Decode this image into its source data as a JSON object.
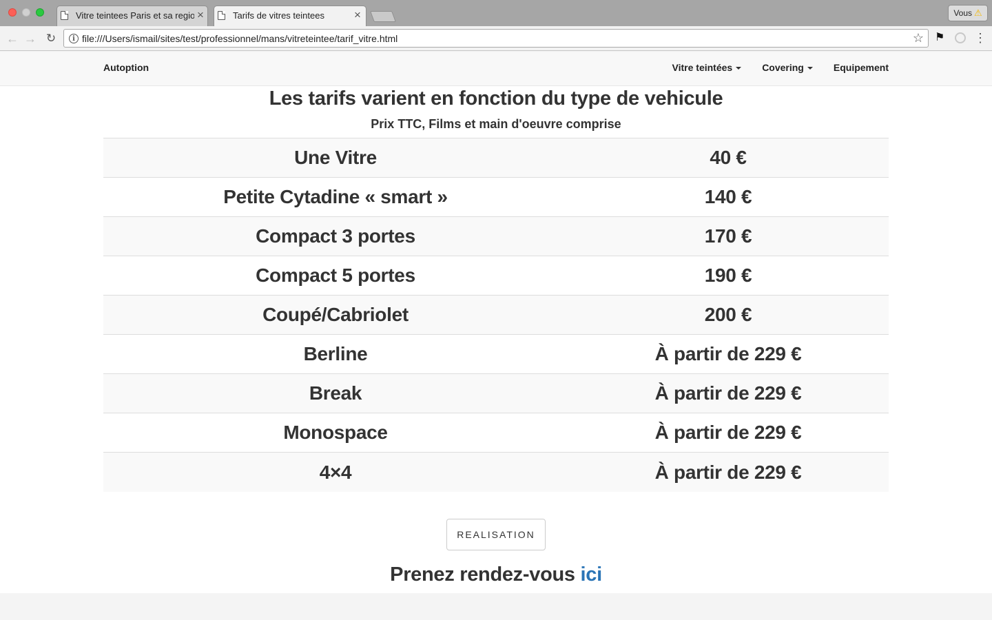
{
  "browser": {
    "tabs": [
      {
        "title": "Vitre teintees Paris et sa region"
      },
      {
        "title": "Tarifs de vitres teintees"
      }
    ],
    "url": "file:///Users/ismail/sites/test/professionnel/mans/vitreteintee/tarif_vitre.html",
    "profile_label": "Vous",
    "icons": {
      "back": "arrow-left-icon",
      "forward": "arrow-right-icon",
      "reload": "reload-icon",
      "info": "info-icon",
      "bookmark": "star-icon",
      "menu": "vertical-dots-icon"
    }
  },
  "navbar": {
    "brand": "Autoption",
    "links": [
      {
        "label": "Vitre teintées",
        "dropdown": true
      },
      {
        "label": "Covering",
        "dropdown": true
      },
      {
        "label": "Equipement",
        "dropdown": false
      }
    ]
  },
  "main": {
    "heading": "Les tarifs varient en fonction du type de vehicule",
    "subheading": "Prix TTC, Films et main d'oeuvre comprise",
    "pricing": [
      {
        "type": "Une Vitre",
        "price": "40 €"
      },
      {
        "type": "Petite Cytadine « smart »",
        "price": "140 €"
      },
      {
        "type": "Compact 3 portes",
        "price": "170 €"
      },
      {
        "type": "Compact 5 portes",
        "price": "190 €"
      },
      {
        "type": "Coupé/Cabriolet",
        "price": "200 €"
      },
      {
        "type": "Berline",
        "price": "À partir de 229 €"
      },
      {
        "type": "Break",
        "price": "À partir de 229 €"
      },
      {
        "type": "Monospace",
        "price": "À partir de 229 €"
      },
      {
        "type": "4×4",
        "price": "À partir de 229 €"
      }
    ],
    "realisation_button": "REALISATION",
    "rdv_text": "Prenez rendez-vous",
    "rdv_link": "ici"
  },
  "colors": {
    "link": "#2a74b6",
    "text": "#333333",
    "stripe": "#f9f9f9"
  }
}
